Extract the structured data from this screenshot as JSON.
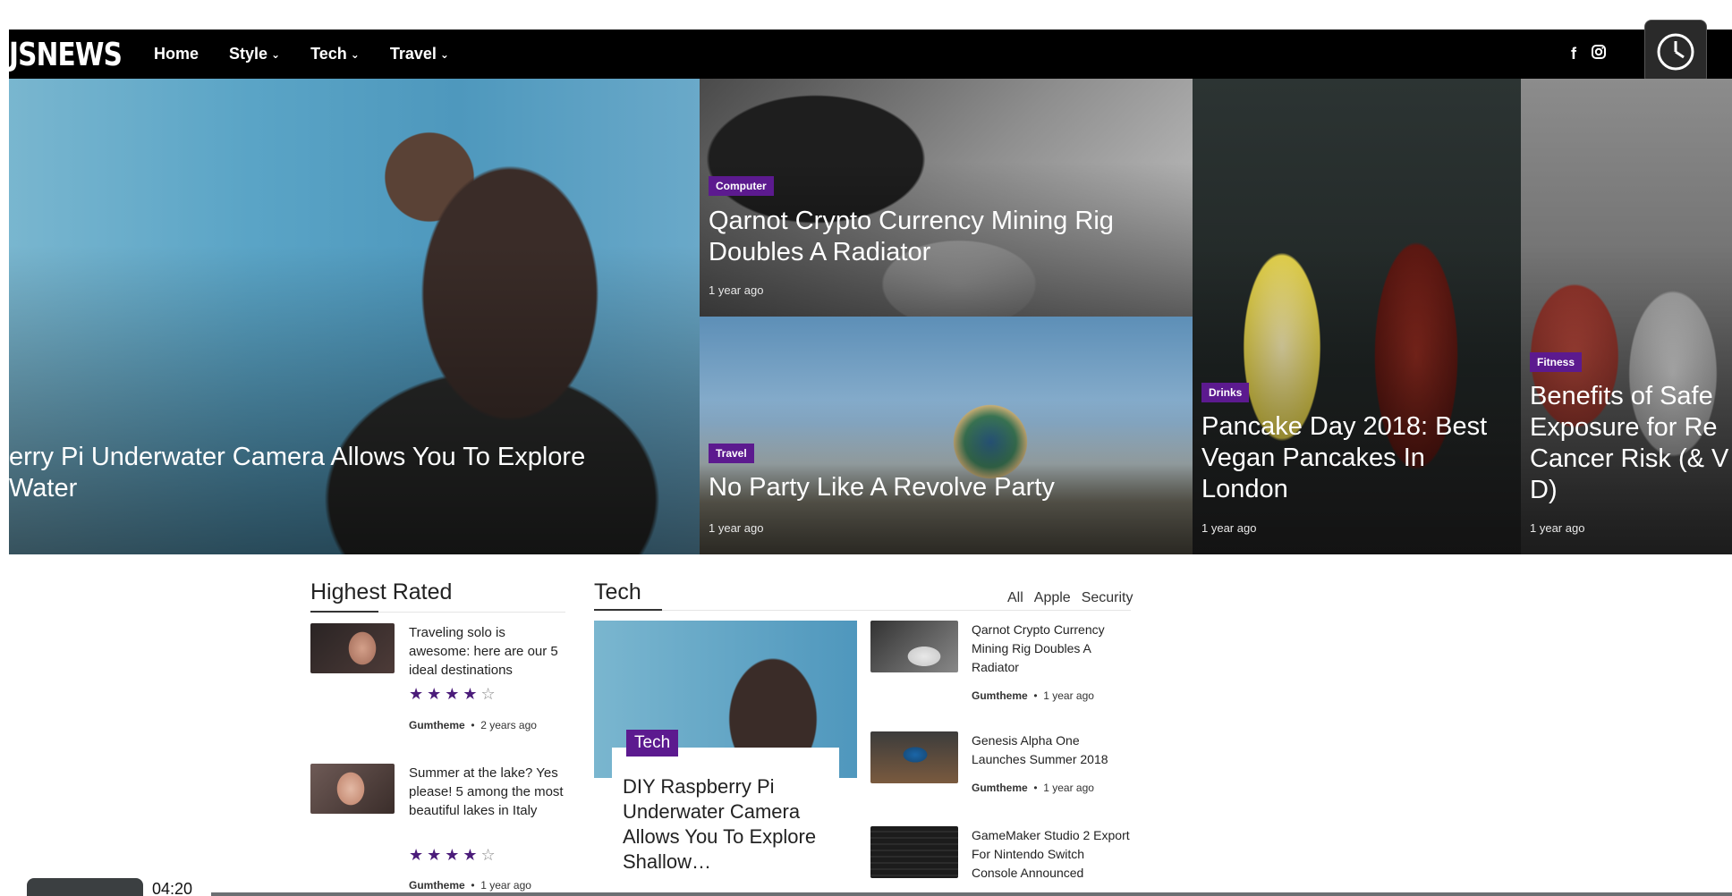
{
  "header": {
    "logo": "JSNEWS",
    "nav": [
      {
        "label": "Home",
        "chevron": false
      },
      {
        "label": "Style",
        "chevron": true
      },
      {
        "label": "Tech",
        "chevron": true
      },
      {
        "label": "Travel",
        "chevron": true
      }
    ],
    "social_icons": [
      "facebook-icon",
      "instagram-icon"
    ]
  },
  "dock": [
    "clock-icon",
    "layers-icon",
    "send-icon"
  ],
  "hero": {
    "main_title": "erry Pi Underwater Camera Allows You To Explore Water",
    "t2": {
      "category": "Computer",
      "title": "Qarnot Crypto Currency Mining Rig Doubles A Radiator",
      "time": "1 year ago"
    },
    "t3": {
      "category": "Travel",
      "title": "No Party Like A Revolve Party",
      "time": "1 year ago"
    },
    "t4": {
      "category": "Drinks",
      "title": "Pancake Day 2018: Best Vegan Pancakes In London",
      "time": "1 year ago"
    },
    "t5": {
      "category": "Fitness",
      "title": "Benefits of Safe Exposure for Re Cancer Risk (& V D)",
      "time": "1 year ago"
    }
  },
  "highest_rated": {
    "title": "Highest Rated",
    "items": [
      {
        "title": "Traveling solo is awesome: here are our 5 ideal destinations",
        "rating": 4,
        "author": "Gumtheme",
        "time": "2 years ago"
      },
      {
        "title": "Summer at the lake? Yes please! 5 among the most beautiful lakes in Italy",
        "rating": 4,
        "author": "Gumtheme",
        "time": "1 year ago"
      }
    ]
  },
  "tech": {
    "title": "Tech",
    "filters": [
      "All",
      "Apple",
      "Security"
    ],
    "featured": {
      "tag": "Tech",
      "title": "DIY Raspberry Pi Underwater Camera Allows You To Explore Shallow…"
    },
    "items": [
      {
        "title": "Qarnot Crypto Currency Mining Rig Doubles A Radiator",
        "author": "Gumtheme",
        "time": "1 year ago"
      },
      {
        "title": "Genesis Alpha One Launches Summer 2018",
        "author": "Gumtheme",
        "time": "1 year ago"
      },
      {
        "title": "GameMaker Studio 2 Export For Nintendo Switch Console Announced",
        "author": "",
        "time": ""
      }
    ]
  },
  "video": {
    "timestamp": "04:20"
  },
  "colors": {
    "accent": "#5c1a8f",
    "stars": "#4b1c7a",
    "navbar": "#000000"
  }
}
